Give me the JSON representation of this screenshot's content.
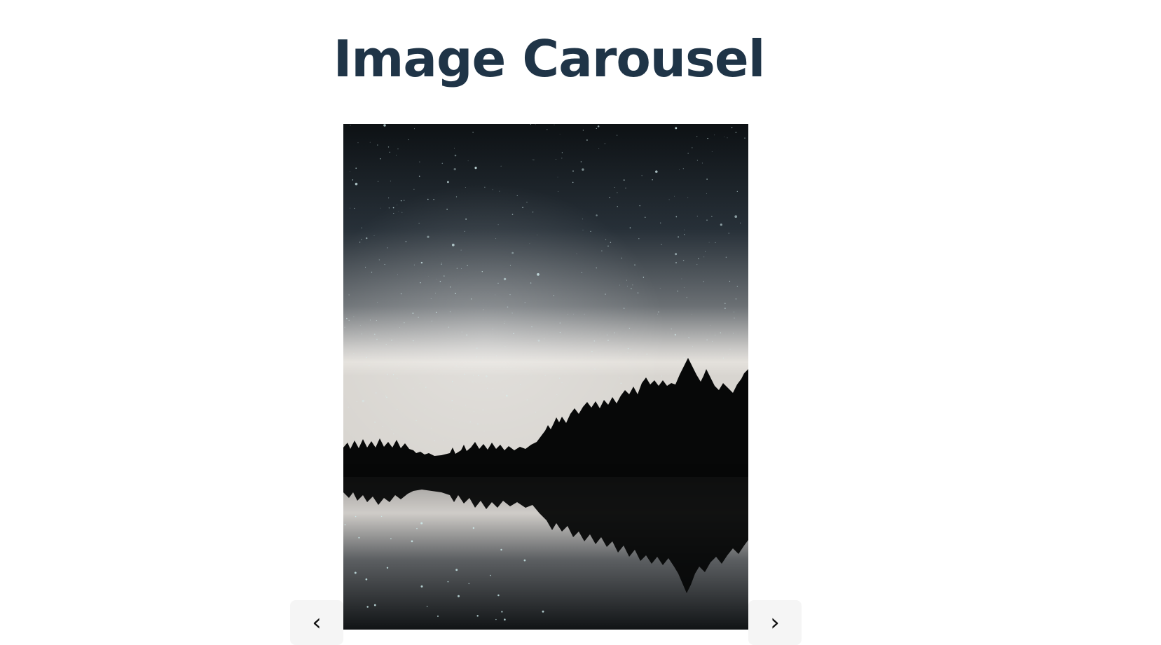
{
  "header": {
    "title": "Image Carousel"
  },
  "carousel": {
    "current_image": "starry night sky over lake with pine tree silhouettes",
    "prev_icon": "chevron-left-icon",
    "next_icon": "chevron-right-icon",
    "prev_glyph": "‹",
    "next_glyph": "›"
  },
  "colors": {
    "title": "#1f3447",
    "button_bg": "#f5f5f5",
    "background": "#ffffff"
  }
}
